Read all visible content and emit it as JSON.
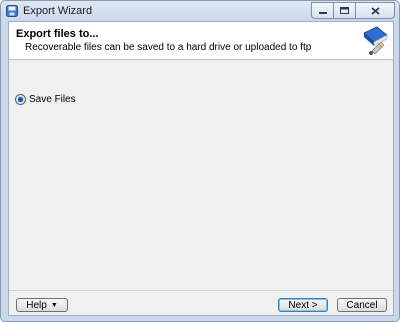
{
  "window": {
    "title": "Export Wizard",
    "icons": {
      "app": "disk-icon",
      "minimize": "minimize-icon",
      "maximize": "maximize-icon",
      "close": "close-icon"
    }
  },
  "header": {
    "title": "Export files to...",
    "subtitle": "Recoverable files can be saved to a hard drive or uploaded to ftp",
    "icon": "book-icon"
  },
  "options": {
    "save_files": {
      "label": "Save Files",
      "selected": true
    }
  },
  "footer": {
    "help_label": "Help",
    "next_label": "Next >",
    "cancel_label": "Cancel"
  }
}
